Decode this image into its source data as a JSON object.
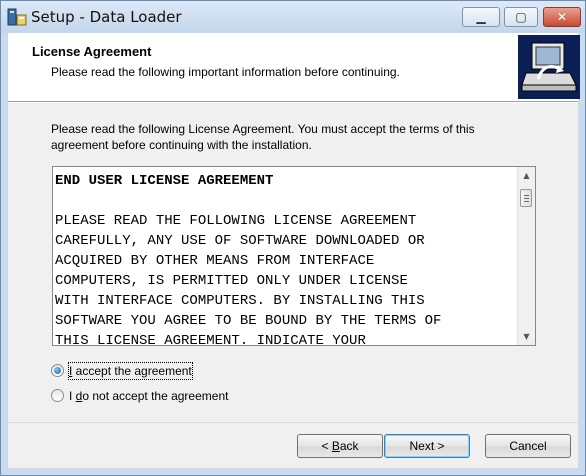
{
  "window": {
    "title": "Setup - Data Loader",
    "controls": {
      "minimize": "▁",
      "maximize": "▢",
      "close": "✕"
    }
  },
  "header": {
    "title": "License Agreement",
    "subtitle": "Please read the following important information before continuing."
  },
  "intro": {
    "line1": "Please read the following License Agreement. You must accept the terms of this",
    "line2": "agreement before continuing with the installation."
  },
  "license": {
    "heading": "END USER LICENSE AGREEMENT",
    "lines": [
      "PLEASE READ THE FOLLOWING LICENSE AGREEMENT",
      "CAREFULLY, ANY USE OF SOFTWARE DOWNLOADED OR",
      "ACQUIRED BY OTHER MEANS FROM INTERFACE",
      "COMPUTERS, IS PERMITTED ONLY UNDER LICENSE",
      "WITH INTERFACE COMPUTERS. BY INSTALLING THIS",
      "SOFTWARE YOU AGREE TO BE BOUND BY THE TERMS OF",
      "THIS LICENSE AGREEMENT. INDICATE YOUR"
    ]
  },
  "options": {
    "accept": {
      "prefix": "",
      "accel": "I",
      "rest": " accept the agreement",
      "selected": true
    },
    "decline": {
      "prefix": "I ",
      "accel": "d",
      "rest": "o not accept the agreement",
      "selected": false
    }
  },
  "buttons": {
    "back": {
      "prefix": "< ",
      "accel": "B",
      "rest": "ack"
    },
    "next": "Next >",
    "cancel": "Cancel"
  },
  "icons": {
    "app": "setup-app-icon",
    "wizard": "wizard-computer-icon",
    "scroll_up": "▲",
    "scroll_down": "▼"
  }
}
